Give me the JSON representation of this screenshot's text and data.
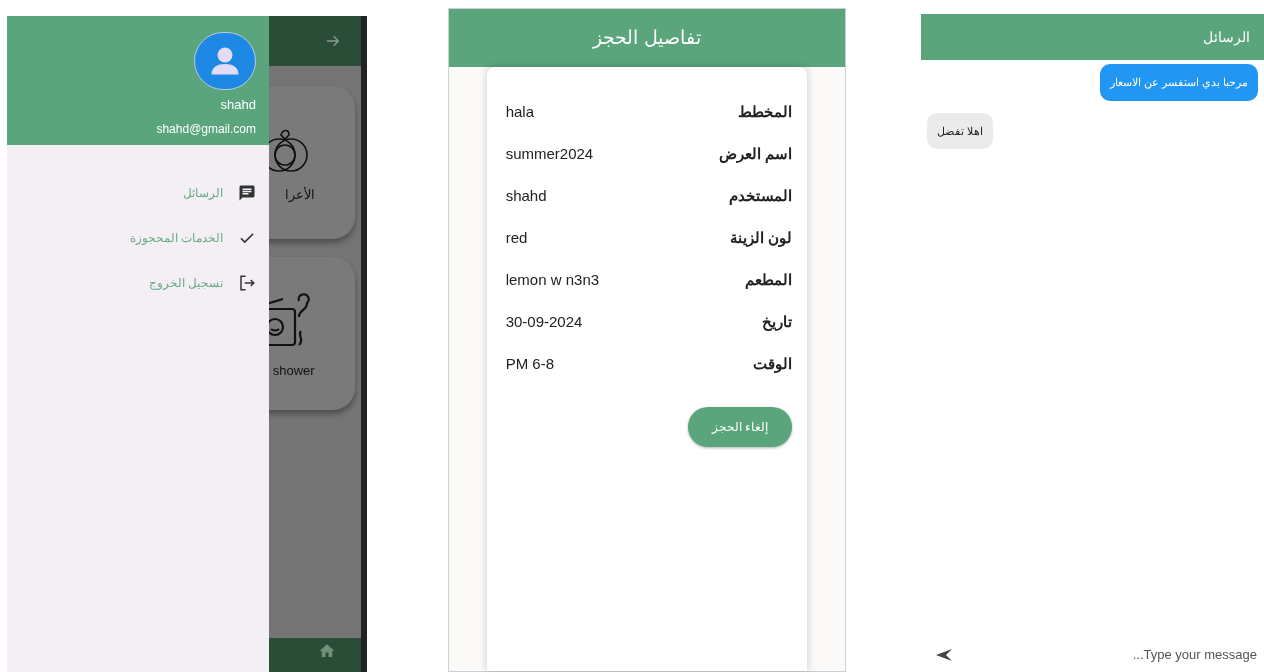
{
  "drawer": {
    "user_name": "shahd",
    "email": "shahd@gmail.com",
    "items": [
      {
        "label": "الرسائل"
      },
      {
        "label": "الخدمات المحجوزة"
      },
      {
        "label": "تسجيل الخروج"
      }
    ]
  },
  "background_app": {
    "cards": [
      {
        "label": "الأعرا"
      },
      {
        "label": "shower"
      }
    ]
  },
  "booking": {
    "title": "تفاصيل الحجز",
    "rows": [
      {
        "label": "المخطط",
        "value": "hala"
      },
      {
        "label": "اسم العرض",
        "value": "summer2024"
      },
      {
        "label": "المستخدم",
        "value": "shahd"
      },
      {
        "label": "لون الزينة",
        "value": "red"
      },
      {
        "label": "المطعم",
        "value": "lemon w n3n3"
      },
      {
        "label": "تاريخ",
        "value": "30-09-2024"
      },
      {
        "label": "الوقت",
        "value": "PM 6-8"
      }
    ],
    "cancel_button": "إلغاء الحجز"
  },
  "chat": {
    "title": "الرسائل",
    "messages": [
      {
        "text": "مرحبا بدي استفسر عن الاسعار",
        "outgoing": true
      },
      {
        "text": "اهلا تفضل",
        "outgoing": false
      }
    ],
    "input": {
      "placeholder": "...Type your message"
    }
  }
}
